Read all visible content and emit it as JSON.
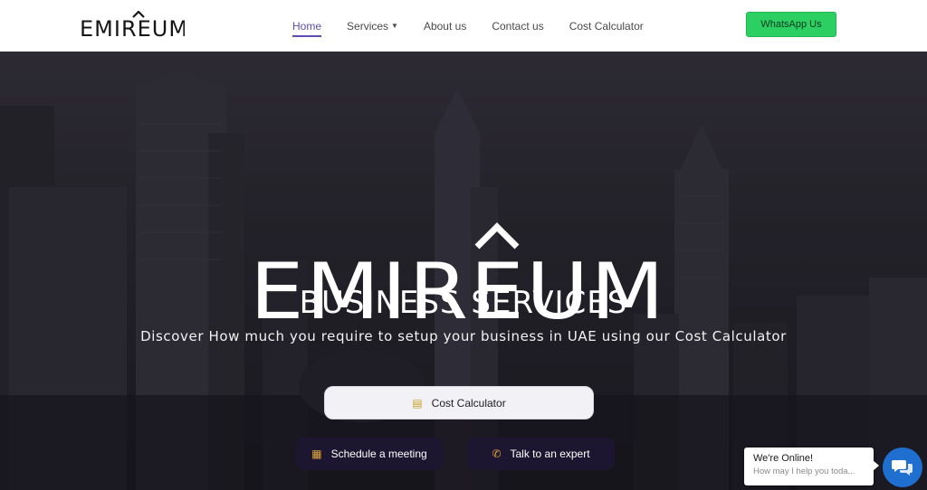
{
  "header": {
    "logo": "EMIREUM",
    "nav": [
      {
        "label": "Home",
        "active": true
      },
      {
        "label": "Services",
        "dropdown": true
      },
      {
        "label": "About us"
      },
      {
        "label": "Contact us"
      },
      {
        "label": "Cost Calculator"
      }
    ],
    "whatsapp_label": "WhatsApp Us"
  },
  "hero": {
    "brand": "EMIREUM",
    "subtitle": "BUSINESS SERVICES",
    "tagline": "Discover How much you require to setup your business in UAE using our Cost Calculator",
    "cost_calculator_label": "Cost Calculator",
    "schedule_label": "Schedule a meeting",
    "talk_label": "Talk to an expert"
  },
  "chat": {
    "title": "We're Online!",
    "subtitle": "How may I help you toda..."
  },
  "colors": {
    "accent": "#5a4fb0",
    "whatsapp": "#2bcf62",
    "dark_button": "#1c1630",
    "chat_blue": "#1f6fd1"
  },
  "icons": {
    "services_dropdown": "chevron-down-icon",
    "cost_calculator": "coins-icon",
    "schedule": "calendar-icon",
    "talk": "phone-icon",
    "chat": "chat-bubbles-icon"
  }
}
